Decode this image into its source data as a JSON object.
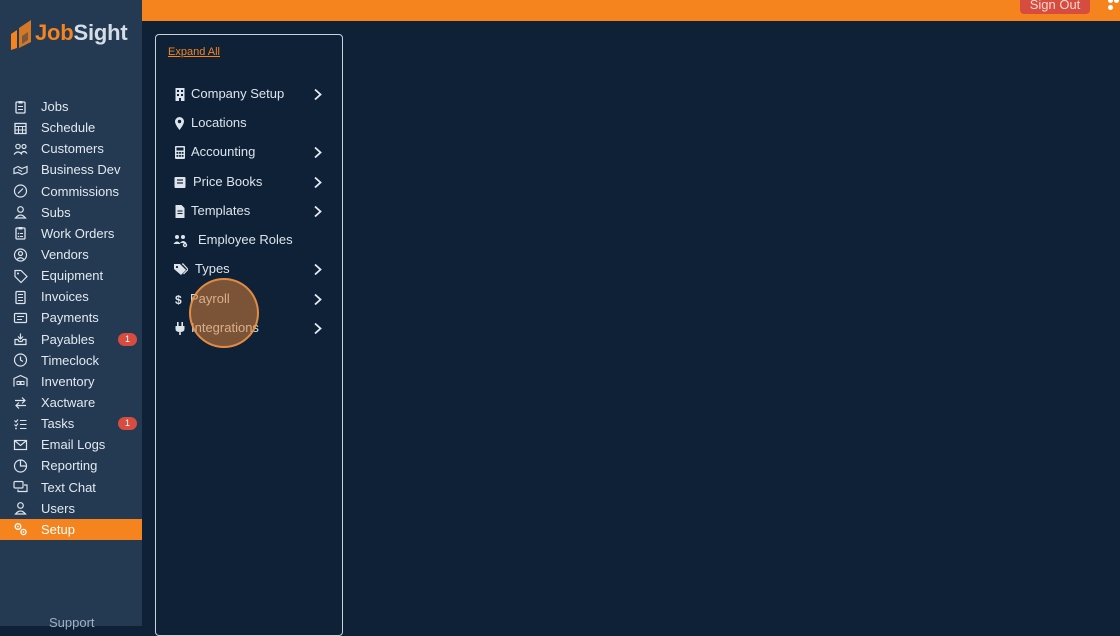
{
  "app": {
    "logo_text_a": "Job",
    "logo_text_b": "Sight"
  },
  "topbar": {
    "signout_label": "Sign Out"
  },
  "sidebar": {
    "items": [
      {
        "label": "Jobs",
        "icon": "clipboard-icon"
      },
      {
        "label": "Schedule",
        "icon": "calendar-icon"
      },
      {
        "label": "Customers",
        "icon": "users-icon"
      },
      {
        "label": "Business Dev",
        "icon": "handshake-icon"
      },
      {
        "label": "Commissions",
        "icon": "percent-circle-icon"
      },
      {
        "label": "Subs",
        "icon": "user-icon"
      },
      {
        "label": "Work Orders",
        "icon": "clipboard-list-icon"
      },
      {
        "label": "Vendors",
        "icon": "user-circle-icon"
      },
      {
        "label": "Equipment",
        "icon": "tag-icon"
      },
      {
        "label": "Invoices",
        "icon": "invoice-icon"
      },
      {
        "label": "Payments",
        "icon": "id-card-icon"
      },
      {
        "label": "Payables",
        "icon": "inbox-icon",
        "badge": "1"
      },
      {
        "label": "Timeclock",
        "icon": "clock-icon"
      },
      {
        "label": "Inventory",
        "icon": "warehouse-icon"
      },
      {
        "label": "Xactware",
        "icon": "swap-icon"
      },
      {
        "label": "Tasks",
        "icon": "tasks-icon",
        "badge": "1"
      },
      {
        "label": "Email Logs",
        "icon": "envelope-icon"
      },
      {
        "label": "Reporting",
        "icon": "chart-pie-icon"
      },
      {
        "label": "Text Chat",
        "icon": "chat-icon"
      },
      {
        "label": "Users",
        "icon": "user-icon"
      },
      {
        "label": "Setup",
        "icon": "gears-icon",
        "active": true
      }
    ],
    "support_label": "Support"
  },
  "setup_panel": {
    "expand_all": "Expand All",
    "items": [
      {
        "label": "Company Setup",
        "icon": "building-icon",
        "has_children": true
      },
      {
        "label": "Locations",
        "icon": "map-pin-icon",
        "has_children": false
      },
      {
        "label": "Accounting",
        "icon": "calculator-icon",
        "has_children": true
      },
      {
        "label": "Price Books",
        "icon": "book-icon",
        "has_children": true
      },
      {
        "label": "Templates",
        "icon": "file-icon",
        "has_children": true
      },
      {
        "label": "Employee Roles",
        "icon": "users-gear-icon",
        "has_children": false
      },
      {
        "label": "Types",
        "icon": "tags-icon",
        "has_children": true
      },
      {
        "label": "Payroll",
        "icon": "dollar-icon",
        "has_children": true
      },
      {
        "label": "Integrations",
        "icon": "plug-icon",
        "has_children": true
      }
    ]
  },
  "colors": {
    "accent": "#f5841f",
    "sidebar": "#233a52",
    "background": "#0f2137",
    "badge": "#d64d3f"
  }
}
